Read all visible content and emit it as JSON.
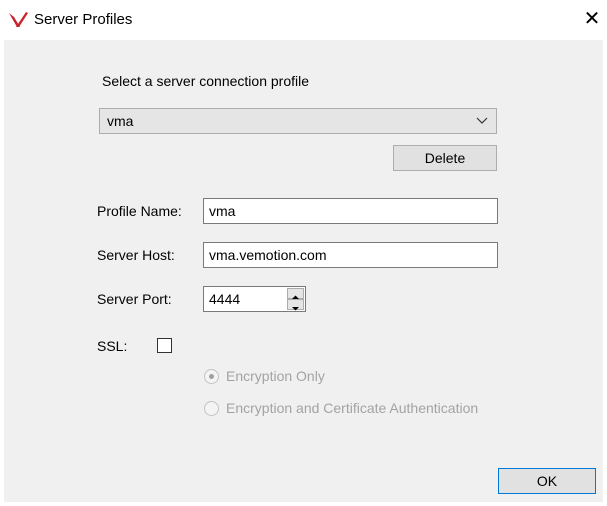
{
  "window": {
    "title": "Server Profiles",
    "close_glyph": "✕"
  },
  "profile_select": {
    "label": "Select a server connection profile",
    "selected": "vma"
  },
  "buttons": {
    "delete": "Delete",
    "ok": "OK"
  },
  "form": {
    "profile_name_label": "Profile Name:",
    "profile_name_value": "vma",
    "server_host_label": "Server Host:",
    "server_host_value": "vma.vemotion.com",
    "server_port_label": "Server Port:",
    "server_port_value": "4444",
    "ssl_label": "SSL:",
    "ssl_checked": false
  },
  "ssl_options": [
    {
      "label": "Encryption Only",
      "selected": true,
      "enabled": false
    },
    {
      "label": "Encryption and Certificate Authentication",
      "selected": false,
      "enabled": false
    }
  ],
  "icons": {
    "app": "vemotion-logo-icon",
    "combo": "chevron-down-icon",
    "spin_up": "arrow-up-icon",
    "spin_down": "arrow-down-icon",
    "close": "close-icon"
  },
  "colors": {
    "client_bg": "#f0f0f0",
    "logo_red": "#c8232c",
    "disabled_text": "#a3a3a3"
  }
}
